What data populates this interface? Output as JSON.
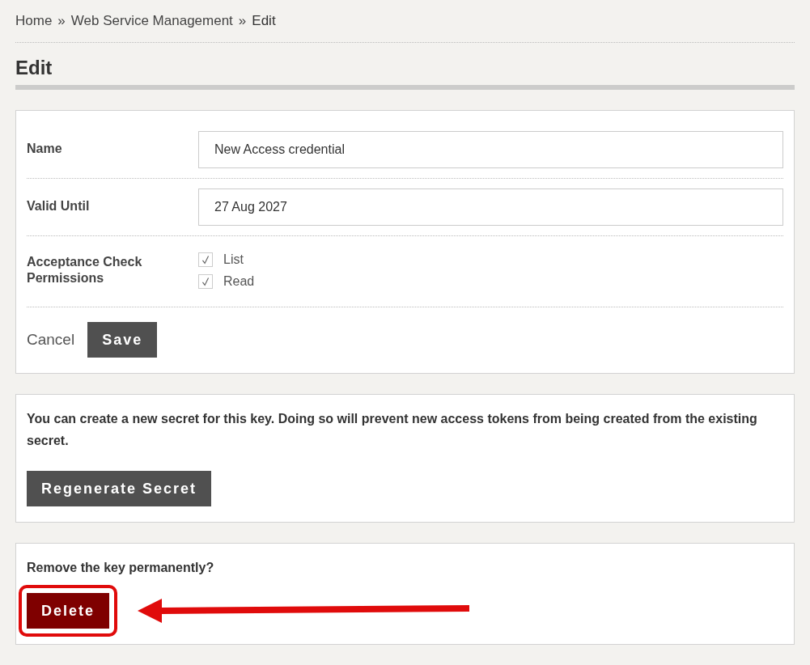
{
  "breadcrumb": [
    {
      "label": "Home",
      "link": true
    },
    {
      "label": "Web Service Management",
      "link": true
    },
    {
      "label": "Edit",
      "link": false
    }
  ],
  "breadcrumb_separator": "»",
  "page_title": "Edit",
  "form": {
    "fields": [
      {
        "kind": "text",
        "label": "Name",
        "value": "New Access credential"
      },
      {
        "kind": "text",
        "label": "Valid Until",
        "value": "27 Aug 2027"
      },
      {
        "kind": "checkboxes",
        "label": "Acceptance Check Permissions",
        "options": [
          {
            "label": "List",
            "checked": true
          },
          {
            "label": "Read",
            "checked": true
          }
        ]
      }
    ],
    "cancel": "Cancel",
    "save": "Save"
  },
  "regenerate": {
    "text": "You can create a new secret for this key. Doing so will prevent new access tokens from being created from the existing secret.",
    "button": "Regenerate Secret"
  },
  "delete": {
    "text": "Remove the key permanently?",
    "button": "Delete",
    "highlighted": true
  }
}
